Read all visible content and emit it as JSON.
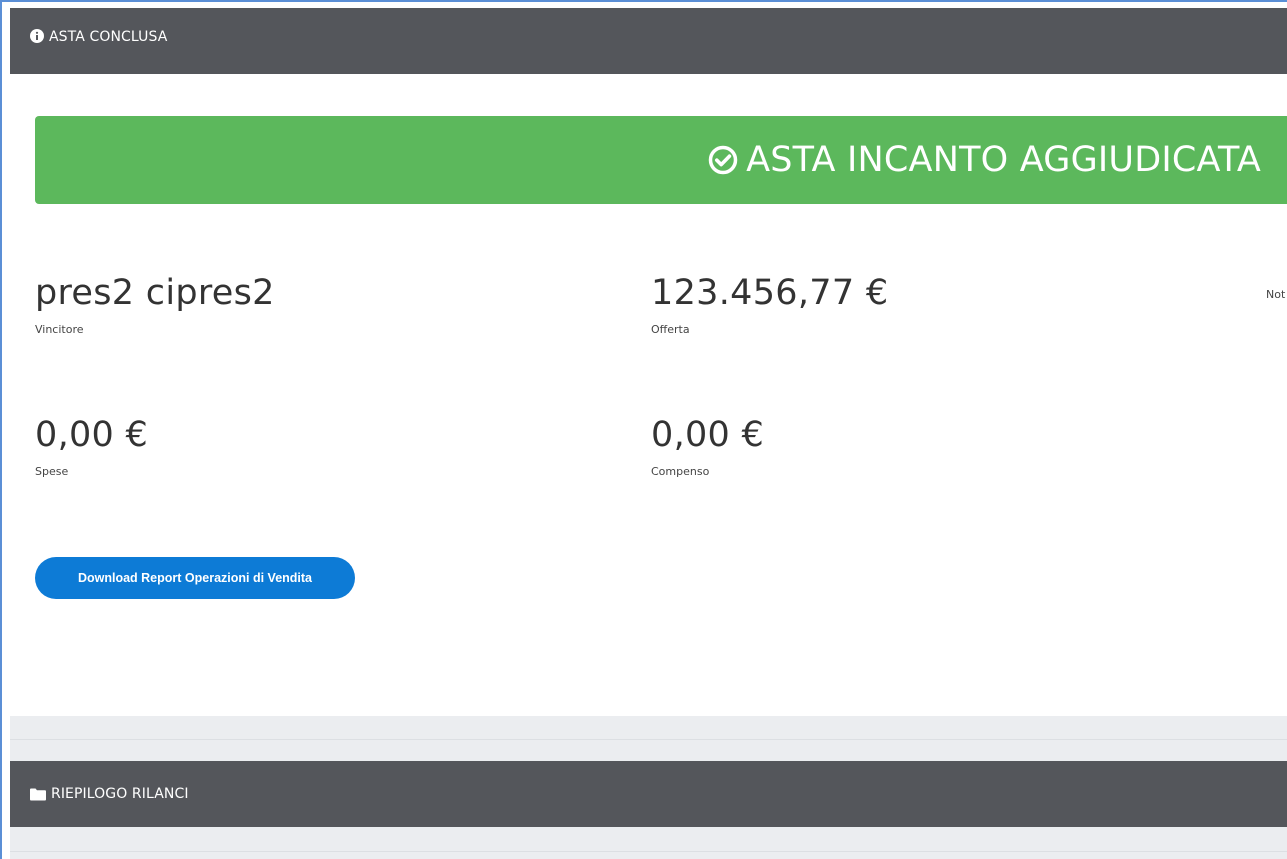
{
  "panel_auction": {
    "title": "ASTA CONCLUSA",
    "icon": "info-circle-icon"
  },
  "banner": {
    "text": "ASTA INCANTO AGGIUDICATA",
    "icon": "check-circle-icon",
    "color": "#5cb85c"
  },
  "stats": {
    "winner": {
      "value": "pres2 cipres2",
      "caption": "Vincitore"
    },
    "offer": {
      "value": "123.456,77 €",
      "caption": "Offerta"
    },
    "truncated_caption": "Not",
    "expenses": {
      "value": "0,00 €",
      "caption": "Spese"
    },
    "fee": {
      "value": "0,00 €",
      "caption": "Compenso"
    }
  },
  "download_button": {
    "label": "Download Report Operazioni di Vendita",
    "color": "#0d7bd6"
  },
  "panel_bids": {
    "title": "RIEPILOGO RILANCI",
    "icon": "folder-icon"
  },
  "colors": {
    "header_bg": "#54565b",
    "frame_border": "#5b8fd6",
    "band_bg": "#ebedf0"
  }
}
